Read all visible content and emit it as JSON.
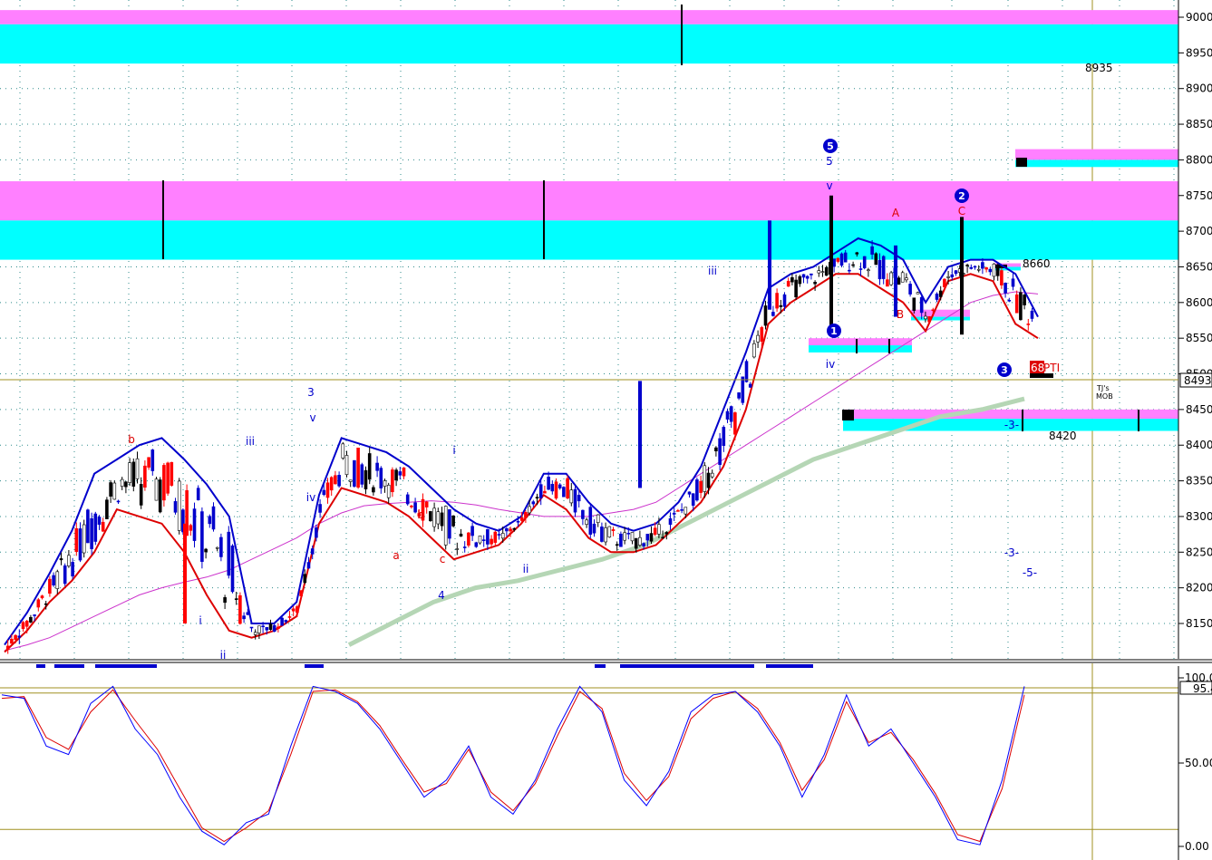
{
  "colors": {
    "zone_pink": "#ff80ff",
    "zone_cyan": "#00ffff",
    "bull_candle": "#0000cc",
    "bear_candle": "#ff0000",
    "neutral_candle": "#000000",
    "band_upper": "#0000cc",
    "band_lower": "#dd0000",
    "ma_magenta": "#cc33cc",
    "ma_green": "#b5d6b5",
    "grid": "#2e8b8b",
    "osc_fast": "#0000ff",
    "osc_slow": "#dd0000",
    "osc_level": "#a09020"
  },
  "price_axis": {
    "ticks": [
      "9000",
      "8950",
      "8900",
      "8850",
      "8800",
      "8750",
      "8700",
      "8650",
      "8600",
      "8550",
      "8500",
      "8450",
      "8400",
      "8350",
      "8300",
      "8250",
      "8200",
      "8150"
    ],
    "last_price": "8493.",
    "range": [
      8108,
      9012
    ]
  },
  "oscillator_axis": {
    "ticks": [
      "100.0",
      "50.00",
      "0.00"
    ],
    "last_value": "95.4",
    "range": [
      -2,
      108
    ],
    "levels": [
      90,
      10
    ]
  },
  "zones": [
    {
      "name": "zone-9000",
      "top": 9010,
      "split": 8990,
      "bottom": 8935
    },
    {
      "name": "zone-8700",
      "top": 8770,
      "split": 8715,
      "bottom": 8660
    },
    {
      "name": "zone-8800",
      "top": 8815,
      "split": 8800,
      "bottom": 8790
    },
    {
      "name": "zone-8660",
      "top": 8655,
      "split": 8650,
      "bottom": 8645
    },
    {
      "name": "zone-8600",
      "top": 8590,
      "split": 8580,
      "bottom": 8575
    },
    {
      "name": "zone-8550",
      "top": 8550,
      "split": 8540,
      "bottom": 8530
    },
    {
      "name": "zone-8420",
      "top": 8450,
      "split": 8437,
      "bottom": 8420
    }
  ],
  "level_labels": [
    "8935",
    "8660",
    "8420"
  ],
  "wave_labels": [
    {
      "text": "b",
      "color": "red"
    },
    {
      "text": "i",
      "color": "blue"
    },
    {
      "text": "ii",
      "color": "blue"
    },
    {
      "text": "iii",
      "color": "blue"
    },
    {
      "text": "3",
      "color": "blue"
    },
    {
      "text": "v",
      "color": "blue"
    },
    {
      "text": "iv",
      "color": "blue"
    },
    {
      "text": "a",
      "color": "red"
    },
    {
      "text": "b",
      "color": "red"
    },
    {
      "text": "c",
      "color": "red"
    },
    {
      "text": "4",
      "color": "blue"
    },
    {
      "text": "i",
      "color": "blue"
    },
    {
      "text": "ii",
      "color": "blue"
    },
    {
      "text": "iii",
      "color": "blue"
    },
    {
      "text": "5",
      "color": "blue"
    },
    {
      "text": "v",
      "color": "blue"
    },
    {
      "text": "iv",
      "color": "blue"
    },
    {
      "text": "A",
      "color": "red"
    },
    {
      "text": "B",
      "color": "red"
    },
    {
      "text": "C",
      "color": "red"
    },
    {
      "text": "-3-",
      "color": "blue"
    },
    {
      "text": "-3-",
      "color": "blue"
    },
    {
      "text": "-5-",
      "color": "blue"
    }
  ],
  "circled_labels": [
    "5",
    "2",
    "1",
    "3"
  ],
  "pti_label": "68",
  "pti_suffix": "PTI",
  "mob_label_line1": "TJ's",
  "mob_label_line2": "MOB",
  "chart_data": {
    "type": "candlestick",
    "subtype": "price chart with Elliott wave labels, bands, moving averages and stochastic oscillator",
    "price_ylim": [
      8108,
      9012
    ],
    "oscillator_ylim": [
      -2,
      108
    ],
    "series": [
      {
        "name": "upper_band",
        "values": [
          8120,
          8165,
          8220,
          8280,
          8360,
          8380,
          8400,
          8410,
          8380,
          8345,
          8300,
          8150,
          8150,
          8180,
          8330,
          8410,
          8400,
          8390,
          8370,
          8340,
          8310,
          8290,
          8280,
          8300,
          8360,
          8360,
          8320,
          8290,
          8280,
          8290,
          8320,
          8370,
          8450,
          8530,
          8620,
          8640,
          8650,
          8670,
          8690,
          8680,
          8660,
          8600,
          8650,
          8660,
          8660,
          8640,
          8580
        ]
      },
      {
        "name": "lower_band",
        "values": [
          8110,
          8140,
          8180,
          8210,
          8250,
          8310,
          8300,
          8290,
          8250,
          8190,
          8140,
          8130,
          8140,
          8160,
          8290,
          8340,
          8330,
          8320,
          8300,
          8270,
          8240,
          8250,
          8260,
          8290,
          8330,
          8310,
          8270,
          8250,
          8250,
          8260,
          8290,
          8320,
          8370,
          8450,
          8570,
          8600,
          8620,
          8640,
          8640,
          8620,
          8600,
          8560,
          8630,
          8640,
          8630,
          8570,
          8550
        ]
      },
      {
        "name": "ma_magenta",
        "values": [
          8112,
          8120,
          8130,
          8145,
          8160,
          8175,
          8190,
          8200,
          8208,
          8215,
          8225,
          8240,
          8255,
          8270,
          8290,
          8305,
          8315,
          8318,
          8320,
          8322,
          8320,
          8316,
          8310,
          8305,
          8300,
          8300,
          8300,
          8305,
          8310,
          8320,
          8340,
          8360,
          8380,
          8400,
          8420,
          8440,
          8460,
          8480,
          8500,
          8520,
          8540,
          8560,
          8580,
          8600,
          8610,
          8615,
          8612
        ]
      },
      {
        "name": "ma_green",
        "values": [
          8120,
          8150,
          8180,
          8200,
          8210,
          8225,
          8240,
          8260,
          8290,
          8320,
          8350,
          8380,
          8400,
          8420,
          8440,
          8450,
          8465
        ]
      },
      {
        "name": "osc_fast",
        "values": [
          90,
          88,
          60,
          55,
          85,
          95,
          70,
          55,
          30,
          10,
          2,
          15,
          20,
          60,
          95,
          92,
          85,
          70,
          50,
          30,
          40,
          60,
          30,
          20,
          40,
          70,
          95,
          80,
          40,
          25,
          45,
          80,
          90,
          92,
          80,
          60,
          30,
          55,
          90,
          60,
          70,
          50,
          30,
          5,
          2,
          40,
          95
        ]
      },
      {
        "name": "osc_slow",
        "values": [
          88,
          89,
          65,
          58,
          80,
          93,
          75,
          58,
          35,
          12,
          4,
          12,
          22,
          55,
          92,
          93,
          86,
          72,
          52,
          33,
          38,
          58,
          33,
          22,
          38,
          66,
          92,
          82,
          44,
          28,
          42,
          76,
          88,
          92,
          82,
          62,
          34,
          52,
          86,
          62,
          68,
          52,
          32,
          8,
          4,
          35,
          90
        ]
      }
    ],
    "title": "",
    "xlabel": "",
    "ylabel": "",
    "grid": true
  }
}
